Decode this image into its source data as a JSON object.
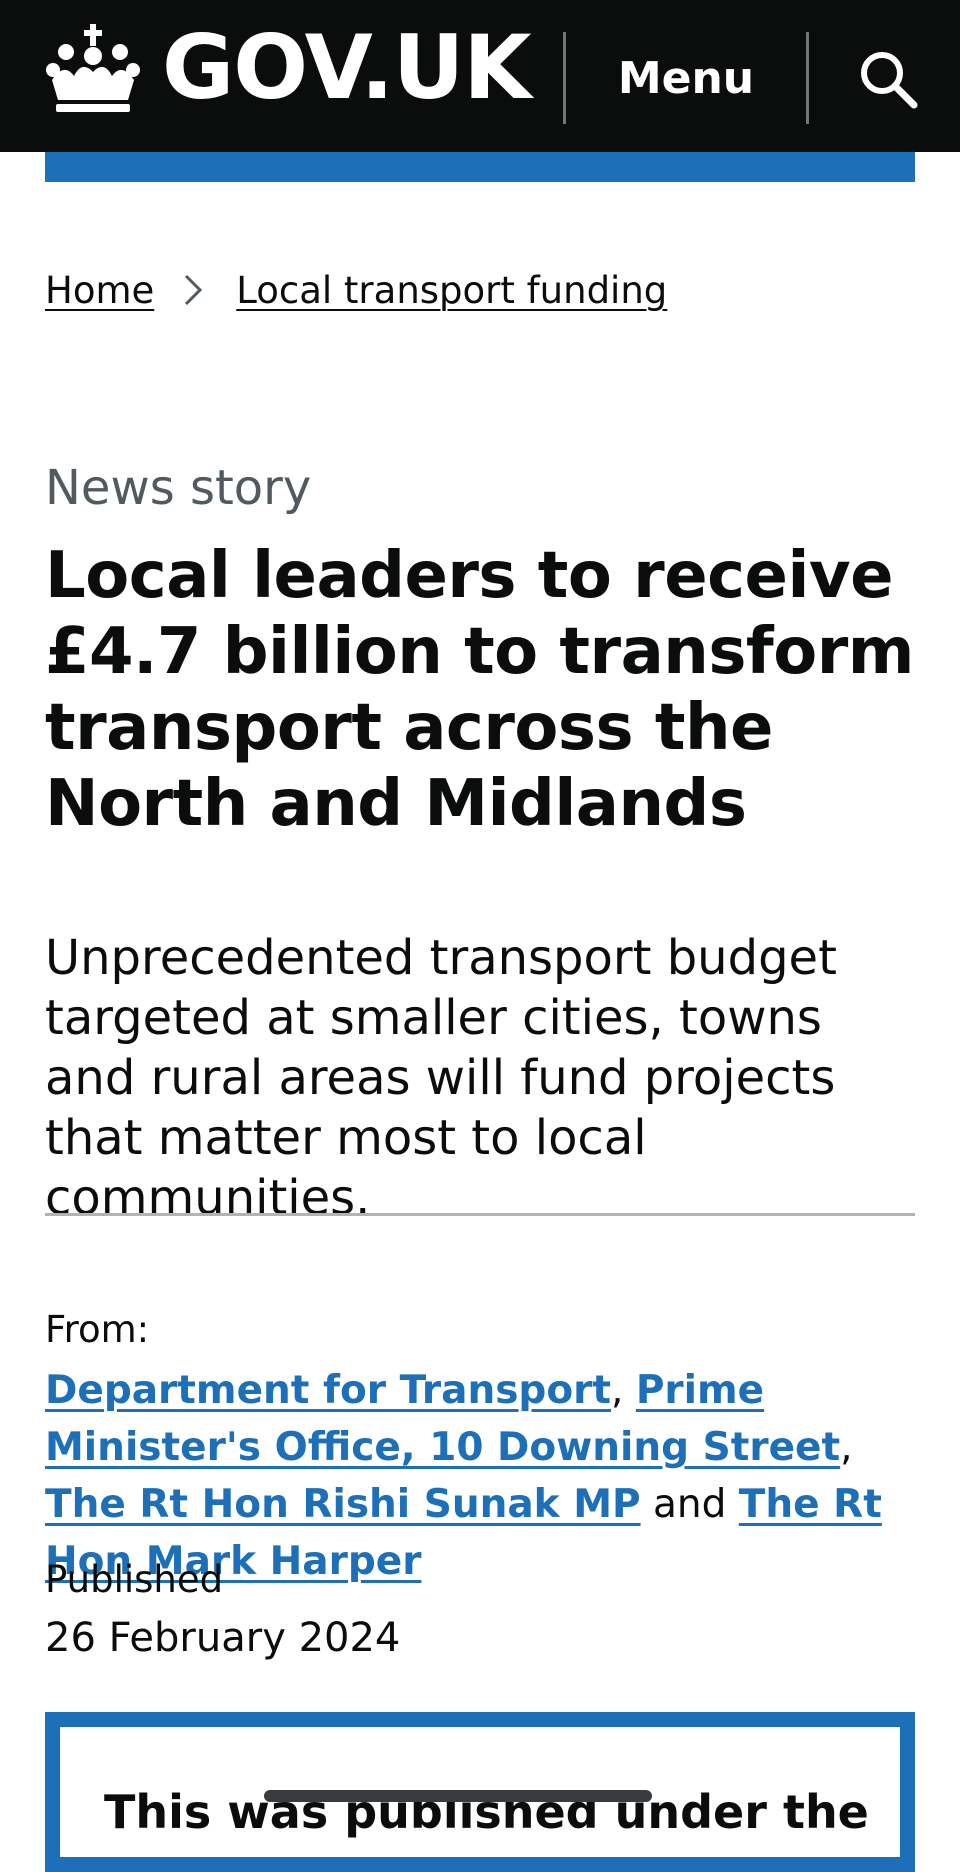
{
  "header": {
    "logo_text": "GOV.UK",
    "menu_label": "Menu",
    "icons": [
      "crown-icon",
      "search-icon"
    ],
    "background_color": "#0b0c0c",
    "accent_color": "#1d70b8"
  },
  "breadcrumbs": [
    {
      "label": "Home"
    },
    {
      "label": "Local transport funding"
    }
  ],
  "article": {
    "caption": "News story",
    "title": "Local leaders to receive £4.7 billion to transform transport across the North and Midlands",
    "lead": "Unprecedented transport budget targeted at smaller cities, towns and rural areas will fund projects that matter most to local communities."
  },
  "metadata": {
    "from_label": "From:",
    "organisations": [
      "Department for Transport",
      "Prime Minister's Office, 10 Downing Street",
      "The Rt Hon Rishi Sunak MP",
      "The Rt Hon Mark Harper"
    ],
    "separator_comma": ",",
    "separator_and": "and",
    "published_label": "Published",
    "published_date": "26 February 2024",
    "link_color": "#1d70b8"
  },
  "notice": {
    "text": "This was published under the"
  }
}
